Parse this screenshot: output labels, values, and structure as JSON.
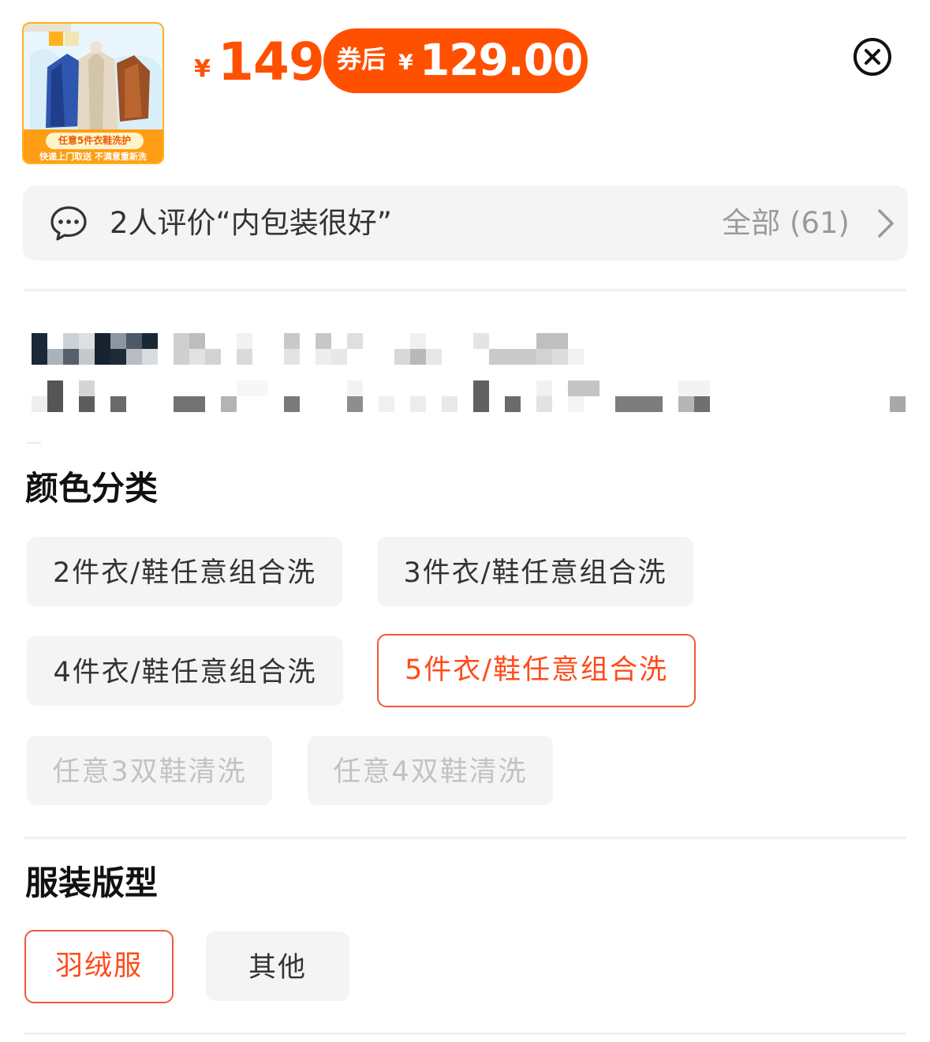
{
  "product": {
    "image_text": {
      "badge": "任意5件衣鞋洗护",
      "sub": "快递上门取送 不满意重新洗"
    },
    "price_currency": "¥",
    "price": "149",
    "coupon_label": "券后",
    "coupon_currency": "¥",
    "coupon_price": "129.00"
  },
  "review": {
    "text": "2人评价“内包装很好”",
    "all_label": "全部 (61)"
  },
  "sections": {
    "color": {
      "title": "颜色分类",
      "options": [
        {
          "label": "2件衣/鞋任意组合洗",
          "state": "normal"
        },
        {
          "label": "3件衣/鞋任意组合洗",
          "state": "normal"
        },
        {
          "label": "4件衣/鞋任意组合洗",
          "state": "normal"
        },
        {
          "label": "5件衣/鞋任意组合洗",
          "state": "selected"
        },
        {
          "label": "任意3双鞋清洗",
          "state": "disabled"
        },
        {
          "label": "任意4双鞋清洗",
          "state": "disabled"
        }
      ]
    },
    "style": {
      "title": "服装版型",
      "options": [
        {
          "label": "羽绒服",
          "state": "selected"
        },
        {
          "label": "其他",
          "state": "normal"
        }
      ]
    }
  },
  "colors": {
    "accent": "#ff5000",
    "selected_border": "#f05a36",
    "chip_bg": "#f4f4f4",
    "disabled_text": "#c2c2c2"
  },
  "icons": {
    "close": "close-circle-icon",
    "comment": "comment-bubble-icon",
    "chevron": "chevron-right-icon"
  }
}
